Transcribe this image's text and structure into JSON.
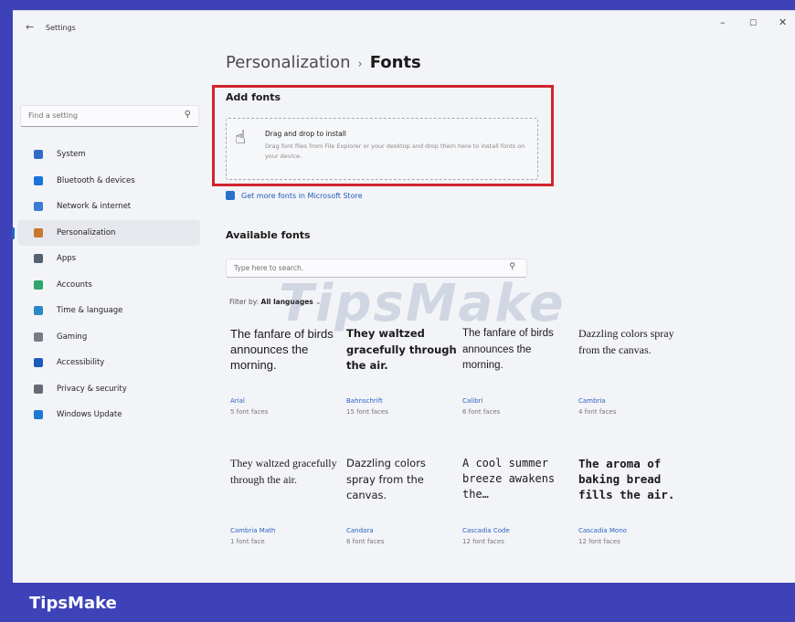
{
  "window": {
    "title": "Settings",
    "back_icon": "back-arrow-icon",
    "controls": {
      "minimize": "–",
      "maximize": "☐",
      "close": "✕"
    }
  },
  "sidebar": {
    "search_placeholder": "Find a setting",
    "items": [
      {
        "label": "System",
        "icon": "monitor-icon",
        "color": "#2e6dc7"
      },
      {
        "label": "Bluetooth & devices",
        "icon": "bluetooth-icon",
        "color": "#1a73d9"
      },
      {
        "label": "Network & internet",
        "icon": "wifi-icon",
        "color": "#3a7bd5"
      },
      {
        "label": "Personalization",
        "icon": "brush-icon",
        "color": "#c9762e",
        "active": true
      },
      {
        "label": "Apps",
        "icon": "apps-icon",
        "color": "#556070"
      },
      {
        "label": "Accounts",
        "icon": "person-icon",
        "color": "#2fa46b"
      },
      {
        "label": "Time & language",
        "icon": "globe-clock-icon",
        "color": "#2c86c8"
      },
      {
        "label": "Gaming",
        "icon": "gamepad-icon",
        "color": "#777b85"
      },
      {
        "label": "Accessibility",
        "icon": "accessibility-icon",
        "color": "#1d5bb8"
      },
      {
        "label": "Privacy & security",
        "icon": "shield-icon",
        "color": "#666b75"
      },
      {
        "label": "Windows Update",
        "icon": "update-icon",
        "color": "#1f79d1"
      }
    ]
  },
  "breadcrumb": {
    "parent": "Personalization",
    "separator": "›",
    "current": "Fonts"
  },
  "add_fonts": {
    "heading": "Add fonts",
    "drop_title": "Drag and drop to install",
    "drop_desc": "Drag font files from File Explorer or your desktop and drop them here to install fonts on your device.",
    "highlight_color": "#d1242c"
  },
  "store_link": "Get more fonts in Microsoft Store",
  "available_fonts": {
    "heading": "Available fonts",
    "search_placeholder": "Type here to search.",
    "filter_label": "Filter by:",
    "filter_value": "All languages",
    "fonts": [
      {
        "sample": "The fanfare of birds announces the morning.",
        "name": "Arial",
        "faces": "5 font faces",
        "family": "\"Liberation Sans\", sans-serif",
        "size": 13,
        "weight": "normal"
      },
      {
        "sample": "They waltzed gracefully through the air.",
        "name": "Bahnschrift",
        "faces": "15 font faces",
        "family": "\"DejaVu Sans\", sans-serif",
        "size": 11.5,
        "weight": "bold"
      },
      {
        "sample": "The fanfare of birds announces the morning.",
        "name": "Calibri",
        "faces": "6 font faces",
        "family": "\"Liberation Sans\", sans-serif",
        "size": 11.5,
        "weight": "normal"
      },
      {
        "sample": "Dazzling colors spray from the canvas.",
        "name": "Cambria",
        "faces": "4 font faces",
        "family": "\"Liberation Serif\", serif",
        "size": 12,
        "weight": "normal"
      },
      {
        "sample": "They waltzed gracefully through the air.",
        "name": "Cambria Math",
        "faces": "1 font face",
        "family": "\"Liberation Serif\", serif",
        "size": 12,
        "weight": "normal"
      },
      {
        "sample": "Dazzling colors spray from the canvas.",
        "name": "Candara",
        "faces": "6 font faces",
        "family": "\"DejaVu Sans\", sans-serif",
        "size": 11.5,
        "weight": "normal"
      },
      {
        "sample": "A cool summer breeze awakens the…",
        "name": "Cascadia Code",
        "faces": "12 font faces",
        "family": "\"DejaVu Sans Mono\", monospace",
        "size": 12,
        "weight": "normal"
      },
      {
        "sample": "The aroma of baking bread fills the air.",
        "name": "Cascadia Mono",
        "faces": "12 font faces",
        "family": "\"DejaVu Sans Mono\", monospace",
        "size": 12.5,
        "weight": "bold"
      }
    ]
  },
  "watermark": "TipsMake",
  "footer_brand": "TipsMake"
}
